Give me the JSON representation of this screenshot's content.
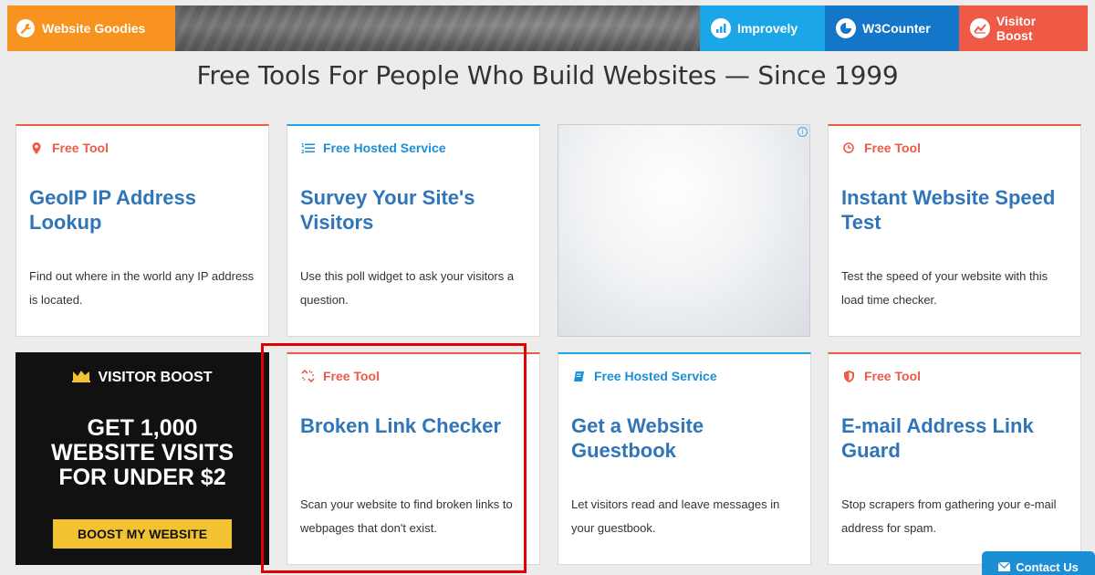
{
  "topbar": {
    "brand_label": "Website Goodies",
    "nav": [
      {
        "label": "Improvely",
        "icon": "bar-chart-icon",
        "color": "#1ba6e8"
      },
      {
        "label": "W3Counter",
        "icon": "pie-chart-icon",
        "color": "#1476c8"
      },
      {
        "label": "Visitor Boost",
        "icon": "trend-chart-icon",
        "color": "#ee5a46"
      }
    ],
    "brand_color": "#f7931e"
  },
  "headline": "Free Tools For People Who Build Websites — Since 1999",
  "cards": [
    {
      "tag": "Free Tool",
      "tag_icon": "map-pin-icon",
      "title": "GeoIP IP Address Lookup",
      "desc": "Find out where in the world any IP address is located."
    },
    {
      "tag": "Free Hosted Service",
      "tag_icon": "list-icon",
      "title": "Survey Your Site's Visitors",
      "desc": "Use this poll widget to ask your visitors a question."
    },
    {
      "tag": "Free Tool",
      "tag_icon": "clock-icon",
      "title": "Instant Website Speed Test",
      "desc": "Test the speed of your website with this load time checker."
    },
    {
      "tag": "Free Tool",
      "tag_icon": "broken-link-icon",
      "title": "Broken Link Checker",
      "desc": "Scan your website to find broken links to webpages that don't exist."
    },
    {
      "tag": "Free Hosted Service",
      "tag_icon": "book-icon",
      "title": "Get a Website Guestbook",
      "desc": "Let visitors read and leave messages in your guestbook."
    },
    {
      "tag": "Free Tool",
      "tag_icon": "shield-icon",
      "title": "E-mail Address Link Guard",
      "desc": "Stop scrapers from gathering your e-mail address for spam."
    }
  ],
  "promo": {
    "title": "VISITOR BOOST",
    "headline_line1": "GET 1,000",
    "headline_line2": "WEBSITE VISITS",
    "headline_line3": "FOR UNDER $2",
    "button": "BOOST MY WEBSITE"
  },
  "ad": {
    "info_icon": "i"
  },
  "contact": {
    "label": "Contact Us"
  },
  "colors": {
    "accent_red": "#ee5a46",
    "accent_blue": "#1ba6e8",
    "title_blue": "#2f75b8",
    "promo_yellow": "#f3c233"
  }
}
